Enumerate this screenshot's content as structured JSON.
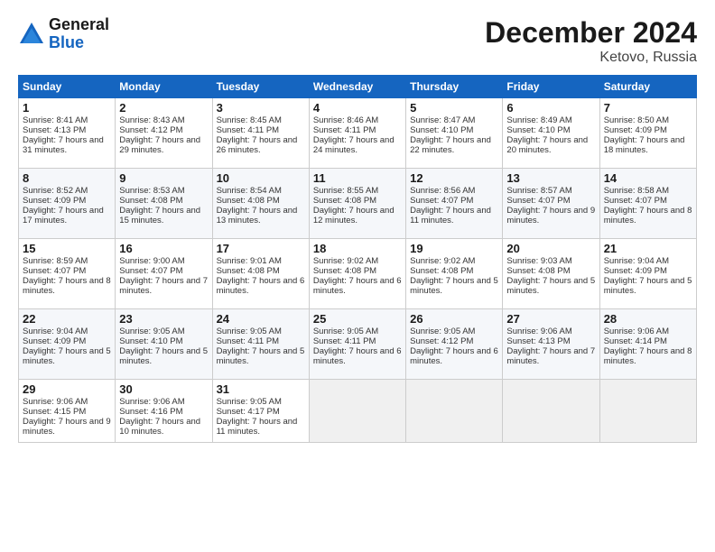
{
  "logo": {
    "line1": "General",
    "line2": "Blue"
  },
  "title": "December 2024",
  "subtitle": "Ketovo, Russia",
  "weekdays": [
    "Sunday",
    "Monday",
    "Tuesday",
    "Wednesday",
    "Thursday",
    "Friday",
    "Saturday"
  ],
  "weeks": [
    [
      {
        "day": "1",
        "sunrise": "Sunrise: 8:41 AM",
        "sunset": "Sunset: 4:13 PM",
        "daylight": "Daylight: 7 hours and 31 minutes."
      },
      {
        "day": "2",
        "sunrise": "Sunrise: 8:43 AM",
        "sunset": "Sunset: 4:12 PM",
        "daylight": "Daylight: 7 hours and 29 minutes."
      },
      {
        "day": "3",
        "sunrise": "Sunrise: 8:45 AM",
        "sunset": "Sunset: 4:11 PM",
        "daylight": "Daylight: 7 hours and 26 minutes."
      },
      {
        "day": "4",
        "sunrise": "Sunrise: 8:46 AM",
        "sunset": "Sunset: 4:11 PM",
        "daylight": "Daylight: 7 hours and 24 minutes."
      },
      {
        "day": "5",
        "sunrise": "Sunrise: 8:47 AM",
        "sunset": "Sunset: 4:10 PM",
        "daylight": "Daylight: 7 hours and 22 minutes."
      },
      {
        "day": "6",
        "sunrise": "Sunrise: 8:49 AM",
        "sunset": "Sunset: 4:10 PM",
        "daylight": "Daylight: 7 hours and 20 minutes."
      },
      {
        "day": "7",
        "sunrise": "Sunrise: 8:50 AM",
        "sunset": "Sunset: 4:09 PM",
        "daylight": "Daylight: 7 hours and 18 minutes."
      }
    ],
    [
      {
        "day": "8",
        "sunrise": "Sunrise: 8:52 AM",
        "sunset": "Sunset: 4:09 PM",
        "daylight": "Daylight: 7 hours and 17 minutes."
      },
      {
        "day": "9",
        "sunrise": "Sunrise: 8:53 AM",
        "sunset": "Sunset: 4:08 PM",
        "daylight": "Daylight: 7 hours and 15 minutes."
      },
      {
        "day": "10",
        "sunrise": "Sunrise: 8:54 AM",
        "sunset": "Sunset: 4:08 PM",
        "daylight": "Daylight: 7 hours and 13 minutes."
      },
      {
        "day": "11",
        "sunrise": "Sunrise: 8:55 AM",
        "sunset": "Sunset: 4:08 PM",
        "daylight": "Daylight: 7 hours and 12 minutes."
      },
      {
        "day": "12",
        "sunrise": "Sunrise: 8:56 AM",
        "sunset": "Sunset: 4:07 PM",
        "daylight": "Daylight: 7 hours and 11 minutes."
      },
      {
        "day": "13",
        "sunrise": "Sunrise: 8:57 AM",
        "sunset": "Sunset: 4:07 PM",
        "daylight": "Daylight: 7 hours and 9 minutes."
      },
      {
        "day": "14",
        "sunrise": "Sunrise: 8:58 AM",
        "sunset": "Sunset: 4:07 PM",
        "daylight": "Daylight: 7 hours and 8 minutes."
      }
    ],
    [
      {
        "day": "15",
        "sunrise": "Sunrise: 8:59 AM",
        "sunset": "Sunset: 4:07 PM",
        "daylight": "Daylight: 7 hours and 8 minutes."
      },
      {
        "day": "16",
        "sunrise": "Sunrise: 9:00 AM",
        "sunset": "Sunset: 4:07 PM",
        "daylight": "Daylight: 7 hours and 7 minutes."
      },
      {
        "day": "17",
        "sunrise": "Sunrise: 9:01 AM",
        "sunset": "Sunset: 4:08 PM",
        "daylight": "Daylight: 7 hours and 6 minutes."
      },
      {
        "day": "18",
        "sunrise": "Sunrise: 9:02 AM",
        "sunset": "Sunset: 4:08 PM",
        "daylight": "Daylight: 7 hours and 6 minutes."
      },
      {
        "day": "19",
        "sunrise": "Sunrise: 9:02 AM",
        "sunset": "Sunset: 4:08 PM",
        "daylight": "Daylight: 7 hours and 5 minutes."
      },
      {
        "day": "20",
        "sunrise": "Sunrise: 9:03 AM",
        "sunset": "Sunset: 4:08 PM",
        "daylight": "Daylight: 7 hours and 5 minutes."
      },
      {
        "day": "21",
        "sunrise": "Sunrise: 9:04 AM",
        "sunset": "Sunset: 4:09 PM",
        "daylight": "Daylight: 7 hours and 5 minutes."
      }
    ],
    [
      {
        "day": "22",
        "sunrise": "Sunrise: 9:04 AM",
        "sunset": "Sunset: 4:09 PM",
        "daylight": "Daylight: 7 hours and 5 minutes."
      },
      {
        "day": "23",
        "sunrise": "Sunrise: 9:05 AM",
        "sunset": "Sunset: 4:10 PM",
        "daylight": "Daylight: 7 hours and 5 minutes."
      },
      {
        "day": "24",
        "sunrise": "Sunrise: 9:05 AM",
        "sunset": "Sunset: 4:11 PM",
        "daylight": "Daylight: 7 hours and 5 minutes."
      },
      {
        "day": "25",
        "sunrise": "Sunrise: 9:05 AM",
        "sunset": "Sunset: 4:11 PM",
        "daylight": "Daylight: 7 hours and 6 minutes."
      },
      {
        "day": "26",
        "sunrise": "Sunrise: 9:05 AM",
        "sunset": "Sunset: 4:12 PM",
        "daylight": "Daylight: 7 hours and 6 minutes."
      },
      {
        "day": "27",
        "sunrise": "Sunrise: 9:06 AM",
        "sunset": "Sunset: 4:13 PM",
        "daylight": "Daylight: 7 hours and 7 minutes."
      },
      {
        "day": "28",
        "sunrise": "Sunrise: 9:06 AM",
        "sunset": "Sunset: 4:14 PM",
        "daylight": "Daylight: 7 hours and 8 minutes."
      }
    ],
    [
      {
        "day": "29",
        "sunrise": "Sunrise: 9:06 AM",
        "sunset": "Sunset: 4:15 PM",
        "daylight": "Daylight: 7 hours and 9 minutes."
      },
      {
        "day": "30",
        "sunrise": "Sunrise: 9:06 AM",
        "sunset": "Sunset: 4:16 PM",
        "daylight": "Daylight: 7 hours and 10 minutes."
      },
      {
        "day": "31",
        "sunrise": "Sunrise: 9:05 AM",
        "sunset": "Sunset: 4:17 PM",
        "daylight": "Daylight: 7 hours and 11 minutes."
      },
      null,
      null,
      null,
      null
    ]
  ]
}
